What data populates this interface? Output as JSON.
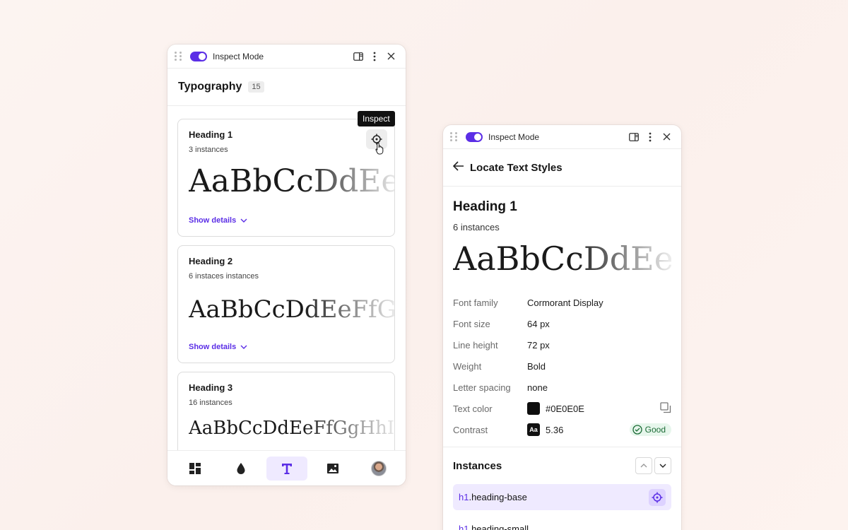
{
  "left_panel": {
    "topbar": {
      "title": "Inspect Mode"
    },
    "section": {
      "title": "Typography",
      "count": "15"
    },
    "tooltip": "Inspect",
    "cards": [
      {
        "name": "Heading 1",
        "instances": "3 instances",
        "sample": "AaBbCcDdEeFf",
        "details": "Show details"
      },
      {
        "name": "Heading 2",
        "instances": "6 instaces instances",
        "sample": "AaBbCcDdEeFfGg",
        "details": "Show details"
      },
      {
        "name": "Heading 3",
        "instances": "16 instances",
        "sample": "AaBbCcDdEeFfGgHhIi"
      }
    ],
    "nav": [
      "dashboard-icon",
      "drop-icon",
      "text-icon",
      "image-icon",
      "avatar"
    ]
  },
  "right_panel": {
    "topbar": {
      "title": "Inspect Mode"
    },
    "header": {
      "title": "Locate Text Styles"
    },
    "style": {
      "name": "Heading 1",
      "instances": "6 instances",
      "sample": "AaBbCcDdEeFf",
      "props": [
        {
          "key": "Font family",
          "value": "Cormorant Display"
        },
        {
          "key": "Font size",
          "value": "64 px"
        },
        {
          "key": "Line height",
          "value": "72 px"
        },
        {
          "key": "Weight",
          "value": "Bold"
        },
        {
          "key": "Letter spacing",
          "value": "none"
        },
        {
          "key": "Text color",
          "value": "#0E0E0E"
        },
        {
          "key": "Contrast",
          "value": "5.36",
          "chip": "Aa",
          "badge": "Good"
        }
      ]
    },
    "instances": {
      "title": "Instances",
      "items": [
        {
          "tag": "h1",
          "cls": ".heading-base"
        },
        {
          "tag": "h1",
          "cls": ".heading-small"
        }
      ]
    }
  },
  "colors": {
    "accent": "#5b2ee6",
    "text_color_swatch": "#0E0E0E",
    "good": "#1b6b35"
  }
}
